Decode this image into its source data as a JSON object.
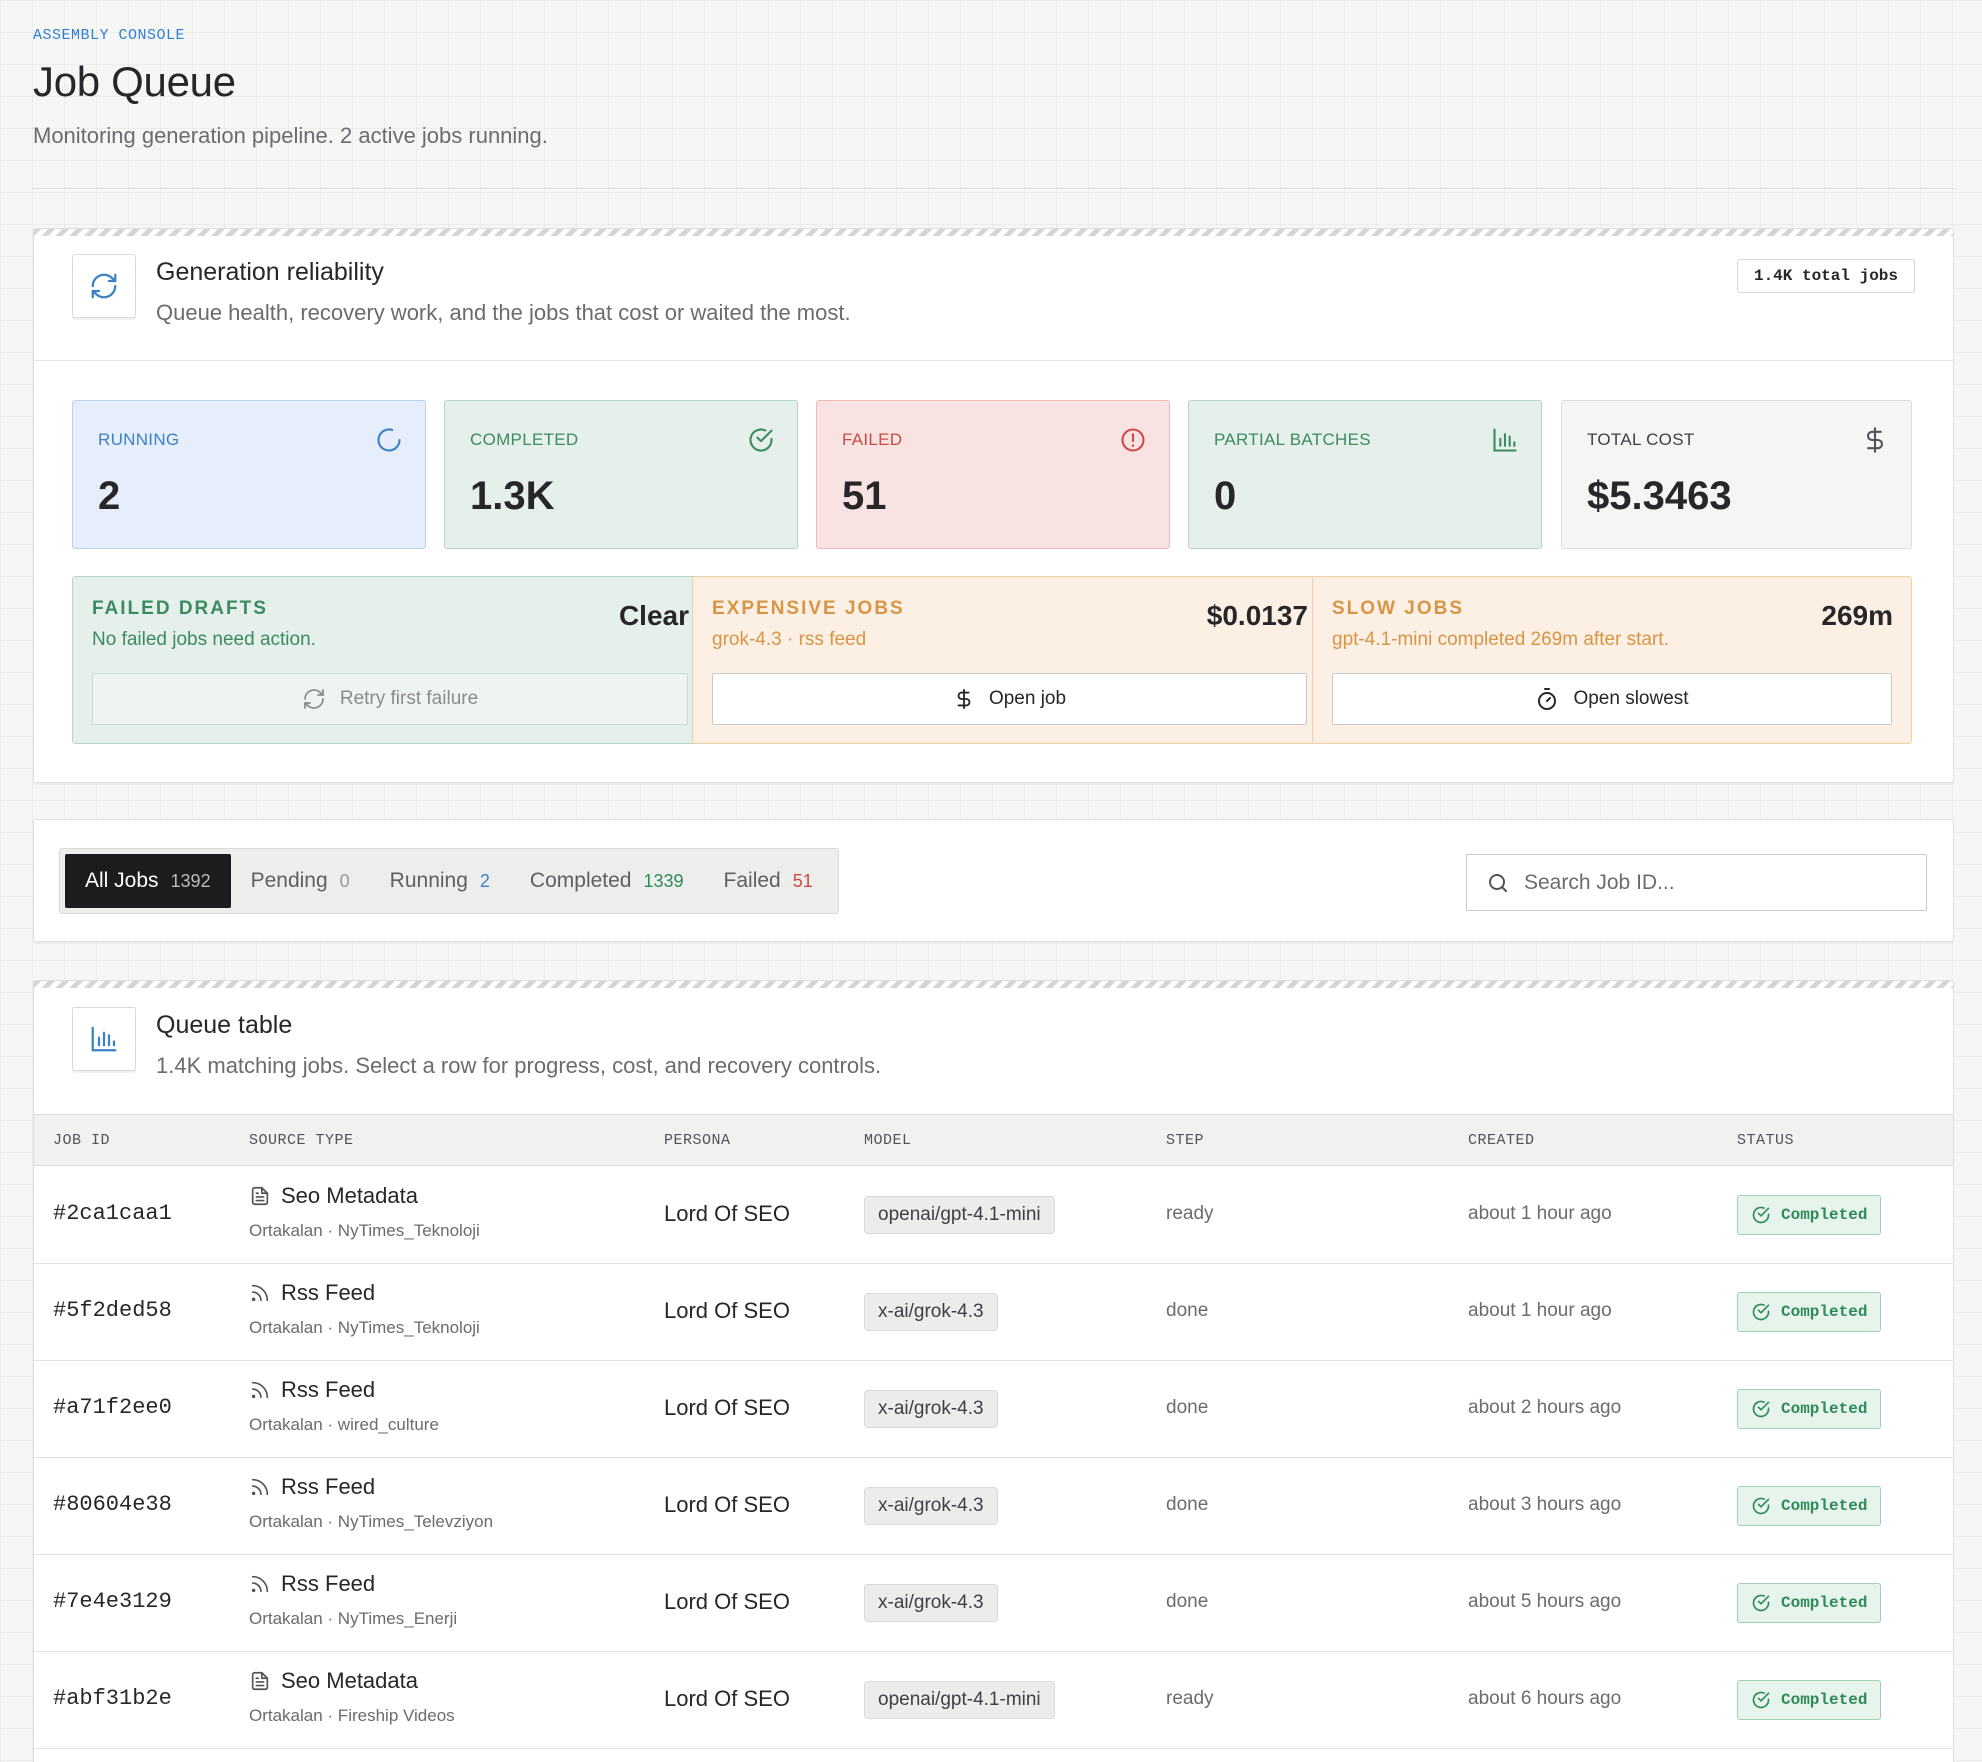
{
  "header": {
    "eyebrow": "ASSEMBLY CONSOLE",
    "title": "Job Queue",
    "subtitle": "Monitoring generation pipeline. 2 active jobs running."
  },
  "reliability": {
    "icon": "refresh-icon",
    "title": "Generation reliability",
    "description": "Queue health, recovery work, and the jobs that cost or waited the most.",
    "total_badge": "1.4K total jobs",
    "stats": {
      "running": {
        "label": "RUNNING",
        "value": "2",
        "icon": "spinner-icon",
        "color": "#3b82c4"
      },
      "completed": {
        "label": "COMPLETED",
        "value": "1.3K",
        "icon": "check-circle-icon",
        "color": "#3c8a62"
      },
      "failed": {
        "label": "FAILED",
        "value": "51",
        "icon": "alert-circle-icon",
        "color": "#cc4a43"
      },
      "partial": {
        "label": "PARTIAL BATCHES",
        "value": "0",
        "icon": "bar-chart-icon",
        "color": "#3c8a62"
      },
      "cost": {
        "label": "TOTAL COST",
        "value": "$5.3463",
        "icon": "dollar-icon",
        "color": "#3f3f46"
      }
    },
    "failed_drafts": {
      "label": "FAILED DRAFTS",
      "subtitle": "No failed jobs need action.",
      "value": "Clear",
      "button": "Retry first failure"
    },
    "expensive_jobs": {
      "label": "EXPENSIVE JOBS",
      "subtitle": "grok-4.3 · rss feed",
      "value": "$0.0137",
      "button": "Open job"
    },
    "slow_jobs": {
      "label": "SLOW JOBS",
      "subtitle": "gpt-4.1-mini completed 269m after start.",
      "value": "269m",
      "button": "Open slowest"
    }
  },
  "filters": {
    "tabs": [
      {
        "label": "All Jobs",
        "count": "1392"
      },
      {
        "label": "Pending",
        "count": "0"
      },
      {
        "label": "Running",
        "count": "2"
      },
      {
        "label": "Completed",
        "count": "1339"
      },
      {
        "label": "Failed",
        "count": "51"
      }
    ],
    "search_placeholder": "Search Job ID..."
  },
  "queue": {
    "icon": "bar-chart-icon",
    "title": "Queue table",
    "description": "1.4K matching jobs. Select a row for progress, cost, and recovery controls.",
    "columns": [
      "JOB ID",
      "SOURCE TYPE",
      "PERSONA",
      "MODEL",
      "STEP",
      "CREATED",
      "STATUS"
    ],
    "rows": [
      {
        "id": "#2ca1caa1",
        "source": "Seo Metadata",
        "source_icon": "document-icon",
        "source_sub": "Ortakalan · NyTimes_Teknoloji",
        "persona": "Lord Of SEO",
        "model": "openai/gpt-4.1-mini",
        "step": "ready",
        "created": "about 1 hour ago",
        "status": "Completed"
      },
      {
        "id": "#5f2ded58",
        "source": "Rss Feed",
        "source_icon": "rss-icon",
        "source_sub": "Ortakalan · NyTimes_Teknoloji",
        "persona": "Lord Of SEO",
        "model": "x-ai/grok-4.3",
        "step": "done",
        "created": "about 1 hour ago",
        "status": "Completed"
      },
      {
        "id": "#a71f2ee0",
        "source": "Rss Feed",
        "source_icon": "rss-icon",
        "source_sub": "Ortakalan · wired_culture",
        "persona": "Lord Of SEO",
        "model": "x-ai/grok-4.3",
        "step": "done",
        "created": "about 2 hours ago",
        "status": "Completed"
      },
      {
        "id": "#80604e38",
        "source": "Rss Feed",
        "source_icon": "rss-icon",
        "source_sub": "Ortakalan · NyTimes_Televziyon",
        "persona": "Lord Of SEO",
        "model": "x-ai/grok-4.3",
        "step": "done",
        "created": "about 3 hours ago",
        "status": "Completed"
      },
      {
        "id": "#7e4e3129",
        "source": "Rss Feed",
        "source_icon": "rss-icon",
        "source_sub": "Ortakalan · NyTimes_Enerji",
        "persona": "Lord Of SEO",
        "model": "x-ai/grok-4.3",
        "step": "done",
        "created": "about 5 hours ago",
        "status": "Completed"
      },
      {
        "id": "#abf31b2e",
        "source": "Seo Metadata",
        "source_icon": "document-icon",
        "source_sub": "Ortakalan · Fireship Videos",
        "persona": "Lord Of SEO",
        "model": "openai/gpt-4.1-mini",
        "step": "ready",
        "created": "about 6 hours ago",
        "status": "Completed"
      }
    ]
  }
}
